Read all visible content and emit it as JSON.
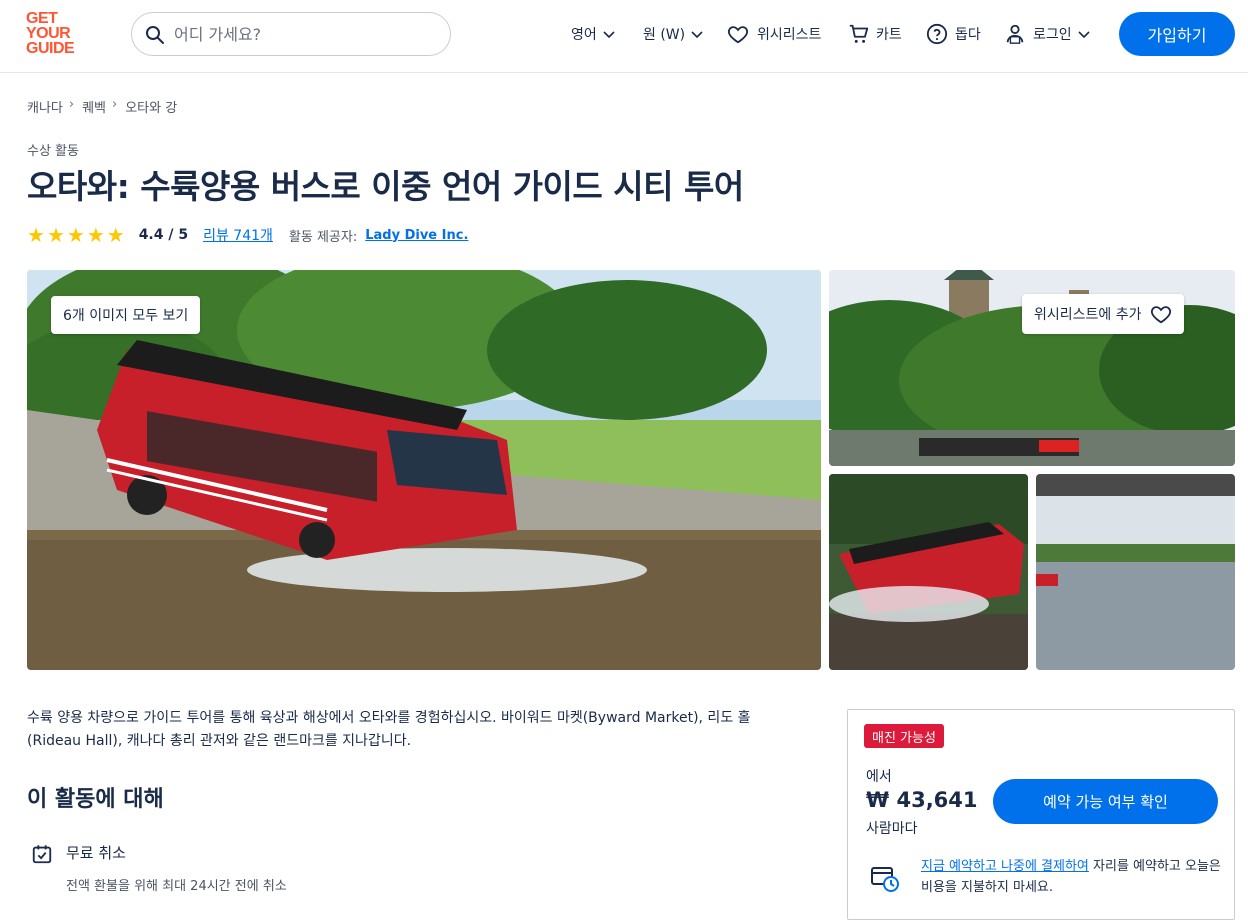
{
  "header": {
    "logo_lines": [
      "GET",
      "YOUR",
      "GUIDE"
    ],
    "search_placeholder": "어디 가세요?",
    "language": "영어",
    "currency": "원 (W)",
    "wishlist": "위시리스트",
    "cart": "카트",
    "help": "돕다",
    "login": "로그인",
    "signup": "가입하기"
  },
  "breadcrumb": [
    "캐나다",
    "퀘벡",
    "오타와 강"
  ],
  "category": "수상 활동",
  "title": "오타와: 수륙양용 버스로 이중 언어 가이드 시티 투어",
  "rating": {
    "stars": 5,
    "value": "4.4 / 5",
    "reviews": "리뷰 741개",
    "provider_label": "활동 제공자:",
    "provider": "Lady Dive Inc."
  },
  "gallery": {
    "see_all": "6개 이미지 모두 보기",
    "add_wishlist": "위시리스트에 추가"
  },
  "description": "수륙 양용 차량으로 가이드 투어를 통해 육상과 해상에서 오타와를 경험하십시오. 바이워드 마켓(Byward Market), 리도 홀(Rideau Hall), 캐나다 총리 관저와 같은 랜드마크를 지나갑니다.",
  "about": {
    "title": "이 활동에 대해",
    "features": [
      {
        "title": "무료 취소",
        "subtitle": "전액 환불을 위해 최대 24시간 전에 취소"
      }
    ]
  },
  "booking": {
    "badge": "매진 가능성",
    "from": "에서",
    "price": "₩ 43,641",
    "per": "사람마다",
    "check_button": "예약 가능 여부 확인",
    "reserve_link": "지금 예약하고 나중에 결제하여",
    "reserve_rest": " 자리를 예약하고 오늘은 비용을 지불하지 마세요."
  },
  "colors": {
    "brand": "#ff5533",
    "primary": "#0071eb",
    "badge": "#dc1a3b",
    "star": "#ffc700"
  }
}
